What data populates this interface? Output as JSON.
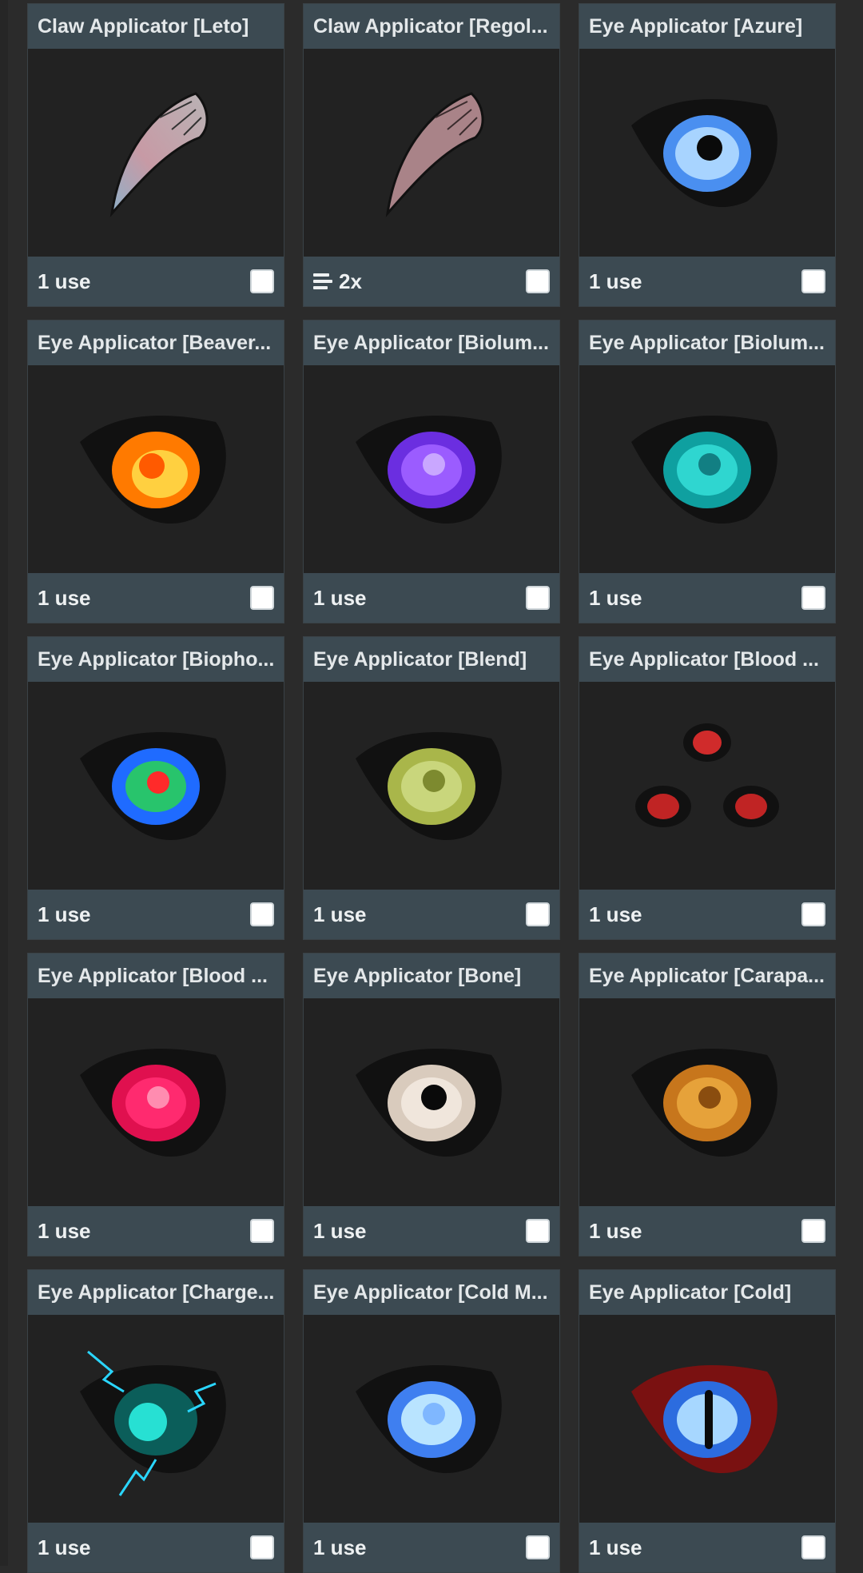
{
  "items": [
    {
      "title": "Claw Applicator [Leto]",
      "uses": "1 use",
      "stacked": false,
      "art": "claw-leto"
    },
    {
      "title": "Claw Applicator [Regol...",
      "uses": "2x",
      "stacked": true,
      "art": "claw-regol"
    },
    {
      "title": "Eye Applicator [Azure]",
      "uses": "1 use",
      "stacked": false,
      "art": "eye-azure"
    },
    {
      "title": "Eye Applicator [Beaver...",
      "uses": "1 use",
      "stacked": false,
      "art": "eye-beaver"
    },
    {
      "title": "Eye Applicator [Biolum...",
      "uses": "1 use",
      "stacked": false,
      "art": "eye-biolum-purple"
    },
    {
      "title": "Eye Applicator [Biolum...",
      "uses": "1 use",
      "stacked": false,
      "art": "eye-biolum-cyan"
    },
    {
      "title": "Eye Applicator [Biopho...",
      "uses": "1 use",
      "stacked": false,
      "art": "eye-biopho"
    },
    {
      "title": "Eye Applicator [Blend]",
      "uses": "1 use",
      "stacked": false,
      "art": "eye-blend"
    },
    {
      "title": "Eye Applicator [Blood ...",
      "uses": "1 use",
      "stacked": false,
      "art": "eye-blood-triple"
    },
    {
      "title": "Eye Applicator [Blood ...",
      "uses": "1 use",
      "stacked": false,
      "art": "eye-blood-pink"
    },
    {
      "title": "Eye Applicator [Bone]",
      "uses": "1 use",
      "stacked": false,
      "art": "eye-bone"
    },
    {
      "title": "Eye Applicator [Carapa...",
      "uses": "1 use",
      "stacked": false,
      "art": "eye-carapace"
    },
    {
      "title": "Eye Applicator [Charge...",
      "uses": "1 use",
      "stacked": false,
      "art": "eye-charged"
    },
    {
      "title": "Eye Applicator [Cold M...",
      "uses": "1 use",
      "stacked": false,
      "art": "eye-cold-m"
    },
    {
      "title": "Eye Applicator [Cold]",
      "uses": "1 use",
      "stacked": false,
      "art": "eye-cold"
    }
  ],
  "colors": {
    "card_bar": "#3c4a52",
    "card_bg": "#222222",
    "page_bg": "#2b2b2b"
  }
}
